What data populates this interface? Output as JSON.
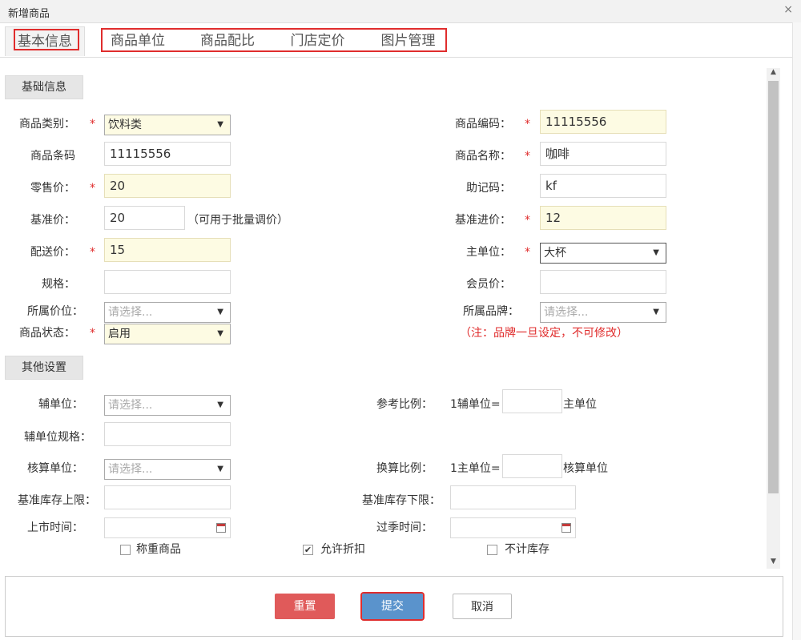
{
  "window": {
    "title": "新增商品",
    "close_icon": "×"
  },
  "tabs": [
    {
      "label": "基本信息"
    },
    {
      "label": "商品单位"
    },
    {
      "label": "商品配比"
    },
    {
      "label": "门店定价"
    },
    {
      "label": "图片管理"
    }
  ],
  "sections": {
    "basic": "基础信息",
    "other": "其他设置"
  },
  "required_mark": "*",
  "form": {
    "category": {
      "label": "商品类别：",
      "value": "饮料类"
    },
    "code": {
      "label": "商品编码：",
      "value": "11115556"
    },
    "barcode": {
      "label": "商品条码",
      "value": "11115556"
    },
    "name": {
      "label": "商品名称：",
      "value": "咖啡"
    },
    "retail_price": {
      "label": "零售价：",
      "value": "20"
    },
    "mnemonic": {
      "label": "助记码：",
      "value": "kf"
    },
    "base_price": {
      "label": "基准价：",
      "value": "20",
      "hint": "（可用于批量调价）"
    },
    "base_cost": {
      "label": "基准进价：",
      "value": "12"
    },
    "delivery_price": {
      "label": "配送价：",
      "value": "15"
    },
    "main_unit": {
      "label": "主单位：",
      "value": "大杯"
    },
    "spec": {
      "label": "规格：",
      "value": ""
    },
    "member_price": {
      "label": "会员价：",
      "value": ""
    },
    "price_band": {
      "label": "所属价位：",
      "placeholder": "请选择..."
    },
    "brand": {
      "label": "所属品牌：",
      "placeholder": "请选择...",
      "note": "（注：品牌一旦设定，不可修改）"
    },
    "status": {
      "label": "商品状态：",
      "value": "启用"
    }
  },
  "other": {
    "aux_unit": {
      "label": "辅单位：",
      "placeholder": "请选择..."
    },
    "ref_ratio": {
      "label": "参考比例：",
      "prefix": "1辅单位=",
      "suffix": "主单位"
    },
    "aux_spec": {
      "label": "辅单位规格："
    },
    "calc_unit": {
      "label": "核算单位：",
      "placeholder": "请选择..."
    },
    "conv_ratio": {
      "label": "换算比例：",
      "prefix": "1主单位=",
      "suffix": "核算单位"
    },
    "stock_upper": {
      "label": "基准库存上限："
    },
    "stock_lower": {
      "label": "基准库存下限："
    },
    "launch_time": {
      "label": "上市时间："
    },
    "offseason_time": {
      "label": "过季时间："
    },
    "weighing": {
      "label": "称重商品",
      "checked": false
    },
    "discount": {
      "label": "允许折扣",
      "checked": true
    },
    "no_stock": {
      "label": "不计库存",
      "checked": false
    }
  },
  "buttons": {
    "reset": "重置",
    "submit": "提交",
    "cancel": "取消"
  },
  "colors": {
    "required": "#e02d2d",
    "reset": "#e05a5a",
    "submit": "#5a93cc",
    "highlight_field": "#fdfbe3"
  }
}
